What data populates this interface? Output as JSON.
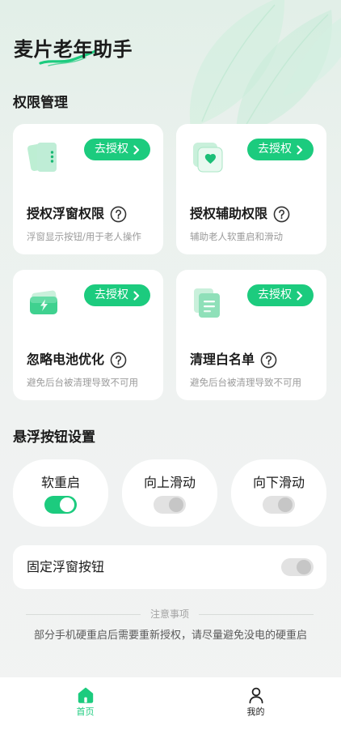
{
  "app": {
    "title": "麦片老年助手"
  },
  "permissions": {
    "heading": "权限管理",
    "cards": [
      {
        "icon": "floating-window-icon",
        "title": "授权浮窗权限",
        "desc": "浮窗显示按钮/用于老人操作",
        "action": "去授权"
      },
      {
        "icon": "accessibility-heart-icon",
        "title": "授权辅助权限",
        "desc": "辅助老人软重启和滑动",
        "action": "去授权"
      },
      {
        "icon": "battery-icon",
        "title": "忽略电池优化",
        "desc": "避免后台被清理导致不可用",
        "action": "去授权"
      },
      {
        "icon": "whitelist-document-icon",
        "title": "清理白名单",
        "desc": "避免后台被清理导致不可用",
        "action": "去授权"
      }
    ]
  },
  "float_settings": {
    "heading": "悬浮按钮设置",
    "toggles": [
      {
        "label": "软重启",
        "on": true
      },
      {
        "label": "向上滑动",
        "on": false
      },
      {
        "label": "向下滑动",
        "on": false
      }
    ],
    "fixed": {
      "label": "固定浮窗按钮",
      "on": false
    }
  },
  "notice": {
    "title": "注意事项",
    "text": "部分手机硬重启后需要重新授权，请尽量避免没电的硬重启"
  },
  "nav": {
    "items": [
      {
        "label": "首页",
        "icon": "home-icon",
        "active": true
      },
      {
        "label": "我的",
        "icon": "person-icon",
        "active": false
      }
    ]
  },
  "colors": {
    "accent": "#1ccb7e",
    "text": "#1b1b1b",
    "muted": "#9b9b9b",
    "card": "#ffffff"
  }
}
